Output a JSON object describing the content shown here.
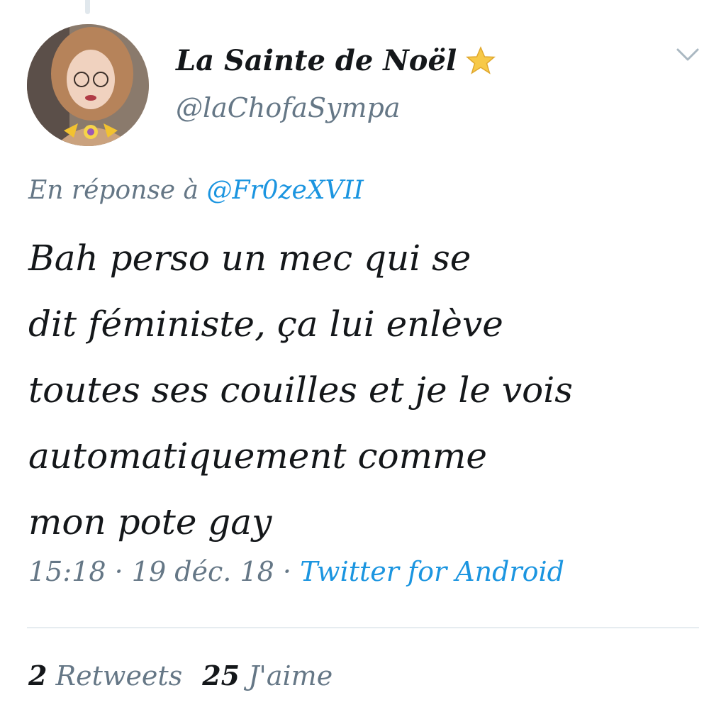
{
  "tweet": {
    "display_name": "La Sainte de Noël",
    "handle": "@laChofaSympa",
    "badge_icon": "star-icon",
    "reply_prefix": "En réponse à ",
    "reply_to": "@Fr0zeXVII",
    "text_lines": [
      "Bah perso un mec qui se",
      "dit féministe, ça lui enlève",
      "toutes ses couilles et je le vois",
      "automatiquement comme",
      "mon pote gay"
    ],
    "time": "15:18",
    "date": "19 déc. 18",
    "separator": " · ",
    "source": "Twitter for Android",
    "retweets_count": "2",
    "retweets_label": "Retweets",
    "likes_count": "25",
    "likes_label": "J'aime"
  },
  "colors": {
    "text_primary": "#14171a",
    "text_secondary": "#657786",
    "link": "#1b95e0",
    "divider": "#e6ecf0"
  }
}
